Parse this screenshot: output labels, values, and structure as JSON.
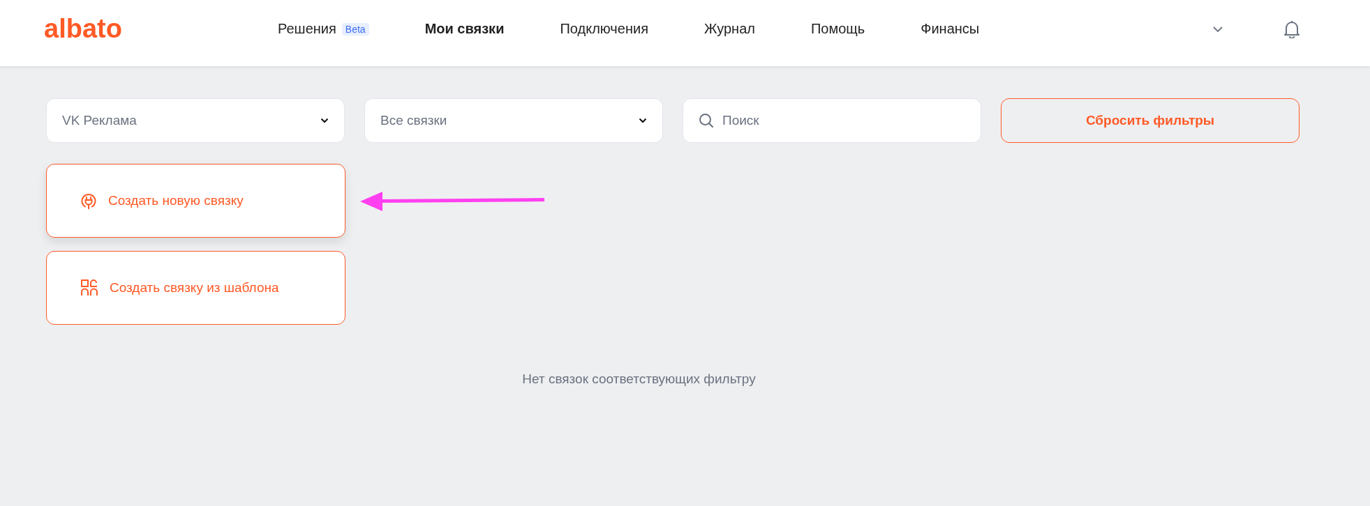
{
  "header": {
    "logo": "albato",
    "nav": [
      {
        "label": "Решения",
        "badge": "Beta",
        "selected": false
      },
      {
        "label": "Мои связки",
        "selected": true
      },
      {
        "label": "Подключения",
        "selected": false
      },
      {
        "label": "Журнал",
        "selected": false
      },
      {
        "label": "Помощь",
        "selected": false
      },
      {
        "label": "Финансы",
        "selected": false
      }
    ]
  },
  "filters": [
    {
      "kind": "select",
      "value": "VK Реклама"
    },
    {
      "kind": "select",
      "value": "Все связки"
    },
    {
      "kind": "search",
      "placeholder": "Поиск"
    },
    {
      "kind": "button",
      "label": "Сбросить фильтры"
    }
  ],
  "actions": [
    {
      "kind": "plug",
      "label": "Создать новую связку",
      "highlighted": true
    },
    {
      "kind": "template",
      "label": "Создать связку из шаблона",
      "highlighted": false
    }
  ],
  "empty_message": "Нет связок соответствующих фильтру"
}
